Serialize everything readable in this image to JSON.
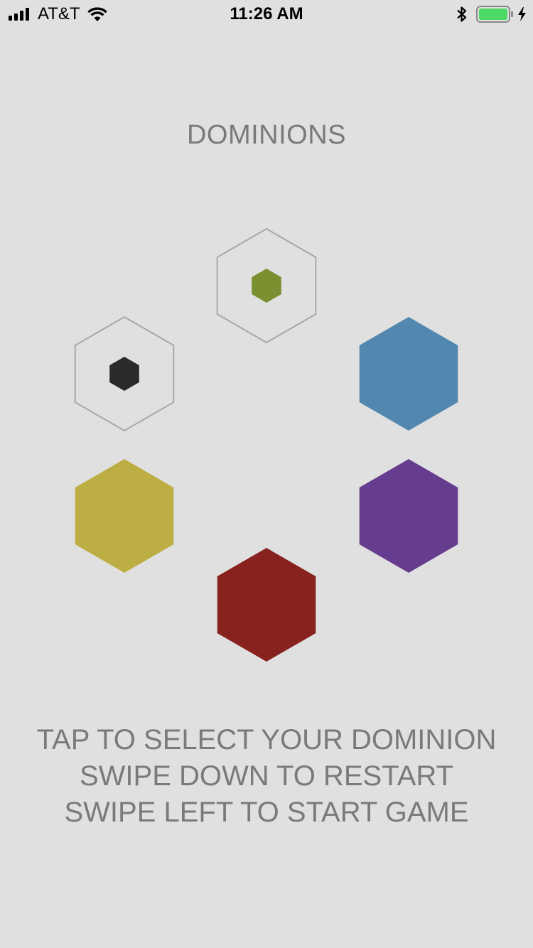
{
  "status_bar": {
    "carrier": "AT&T",
    "time": "11:26 AM",
    "battery_color": "#4cd964",
    "icons": [
      "signal-icon",
      "wifi-icon",
      "bluetooth-icon",
      "battery-icon",
      "charging-icon"
    ]
  },
  "title": "DOMINIONS",
  "dominions": [
    {
      "name": "green",
      "color": "#7a9030",
      "selected": true
    },
    {
      "name": "blue",
      "color": "#5288b0",
      "selected": false
    },
    {
      "name": "purple",
      "color": "#663c8e",
      "selected": false
    },
    {
      "name": "red",
      "color": "#88221e",
      "selected": false
    },
    {
      "name": "yellow",
      "color": "#bdae44",
      "selected": false
    },
    {
      "name": "black",
      "color": "#2a2a2a",
      "selected": true
    }
  ],
  "instructions": {
    "line1": "TAP TO SELECT YOUR DOMINION",
    "line2": "SWIPE DOWN TO RESTART",
    "line3": "SWIPE LEFT TO START GAME"
  },
  "colors": {
    "background": "#e0e0e0",
    "text": "#7a7a7a",
    "outline": "#a8a8a8"
  }
}
